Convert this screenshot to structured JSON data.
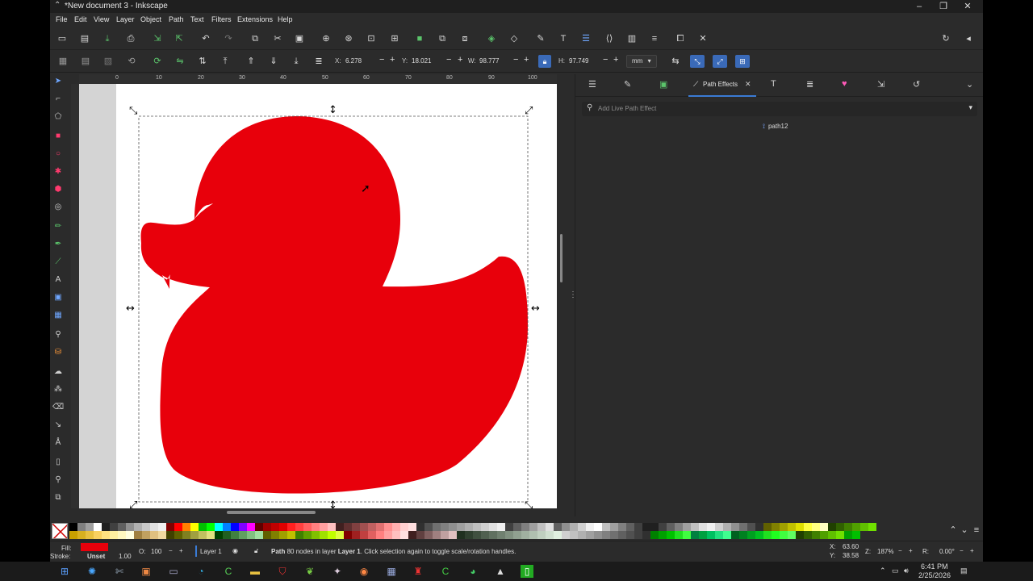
{
  "window": {
    "title": "*New document 3 - Inkscape",
    "minimize": "–",
    "restore": "❐",
    "close": "✕"
  },
  "menu": [
    "File",
    "Edit",
    "View",
    "Layer",
    "Object",
    "Path",
    "Text",
    "Filters",
    "Extensions",
    "Help"
  ],
  "commands": [
    "new-document-icon",
    "open-icon",
    "save-icon",
    "print-icon",
    "import-icon",
    "export-icon",
    "undo-icon",
    "redo-icon",
    "copy-icon",
    "cut-icon",
    "paste-icon",
    "zoom-selection-icon",
    "zoom-drawing-icon",
    "zoom-page-icon",
    "zoom-page-width-icon",
    "duplicate-icon",
    "clone-icon",
    "unlink-clone-icon",
    "group-icon",
    "ungroup-icon",
    "fill-stroke-icon",
    "text-font-icon",
    "layers-icon",
    "xml-editor-icon",
    "align-icon",
    "preferences-icon",
    "document-properties-icon",
    "transform-icon"
  ],
  "toolbar": {
    "x_label": "X:",
    "x_value": "6.278",
    "y_label": "Y:",
    "y_value": "18.021",
    "w_label": "W:",
    "w_value": "98.777",
    "h_label": "H:",
    "h_value": "97.749",
    "unit": "mm",
    "minus": "−",
    "plus": "+"
  },
  "ruler_ticks": [
    "0",
    "10",
    "20",
    "30",
    "40",
    "50",
    "60",
    "70",
    "80",
    "90",
    "100"
  ],
  "dock": {
    "active_tab": "Path Effects",
    "close_tab": "✕",
    "search_placeholder": "Add Live Path Effect",
    "dropdown_glyph": "▾",
    "path_item": "path12"
  },
  "status": {
    "fill_label": "Fill:",
    "stroke_label": "Stroke:",
    "stroke_value": "Unset",
    "stroke_width": "1.00",
    "opacity_label": "O:",
    "opacity_value": "100",
    "layer": "Layer 1",
    "message_bold": "Path",
    "message_mid": " 80 nodes in layer ",
    "message_layer": "Layer 1",
    "message_tail": ". Click selection again to toggle scale/rotation handles.",
    "cursor_x": "63.60",
    "cursor_y": "38.58",
    "x_label": "X:",
    "y_label": "Y:",
    "zoom_label": "Z:",
    "zoom_value": "187%",
    "rotation_label": "R:",
    "rotation_value": "0.00°"
  },
  "taskbar": {
    "time": "6:41 PM",
    "date": "2/25/2026"
  },
  "colors": {
    "accent": "#3a7bd5",
    "fill": "#e8000b",
    "shape": "#e8000b"
  }
}
